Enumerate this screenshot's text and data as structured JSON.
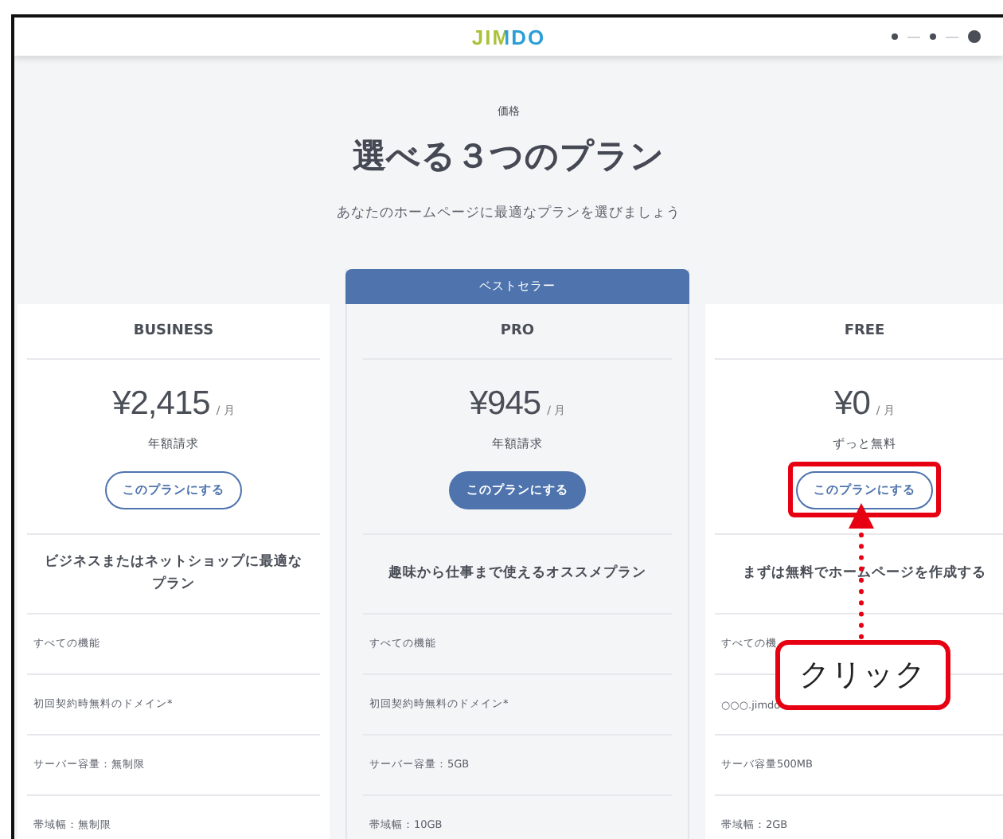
{
  "header": {
    "logo": "JIMDO",
    "steps": [
      {
        "selected": false
      },
      {
        "selected": false
      },
      {
        "selected": true
      }
    ]
  },
  "intro": {
    "eyebrow": "価格",
    "title": "選べる３つのプラン",
    "subtitle": "あなたのホームページに最適なプランを選びましょう"
  },
  "plans": [
    {
      "name": "BUSINESS",
      "price": "¥2,415",
      "per": "/ 月",
      "billing": "年額請求",
      "button": "このプランにする",
      "primary": false,
      "highlighted": false,
      "description": "ビジネスまたはネットショップに最適なプラン",
      "features": [
        "すべての機能",
        "初回契約時無料のドメイン*",
        "サーバー容量：無制限",
        "帯域幅：無制限"
      ]
    },
    {
      "name": "PRO",
      "badge": "ベストセラー",
      "price": "¥945",
      "per": "/ 月",
      "billing": "年額請求",
      "button": "このプランにする",
      "primary": true,
      "highlighted": false,
      "description": "趣味から仕事まで使えるオススメプラン",
      "features": [
        "すべての機能",
        "初回契約時無料のドメイン*",
        "サーバー容量：5GB",
        "帯域幅：10GB"
      ]
    },
    {
      "name": "FREE",
      "price": "¥0",
      "per": "/ 月",
      "billing": "ずっと無料",
      "button": "このプランにする",
      "primary": false,
      "highlighted": true,
      "description": "まずは無料でホームページを作成する",
      "features": [
        "すべての機",
        "○○○.jimdo",
        "サーバ容量500MB",
        "帯域幅：2GB"
      ]
    }
  ],
  "annotation": {
    "callout": "クリック"
  }
}
